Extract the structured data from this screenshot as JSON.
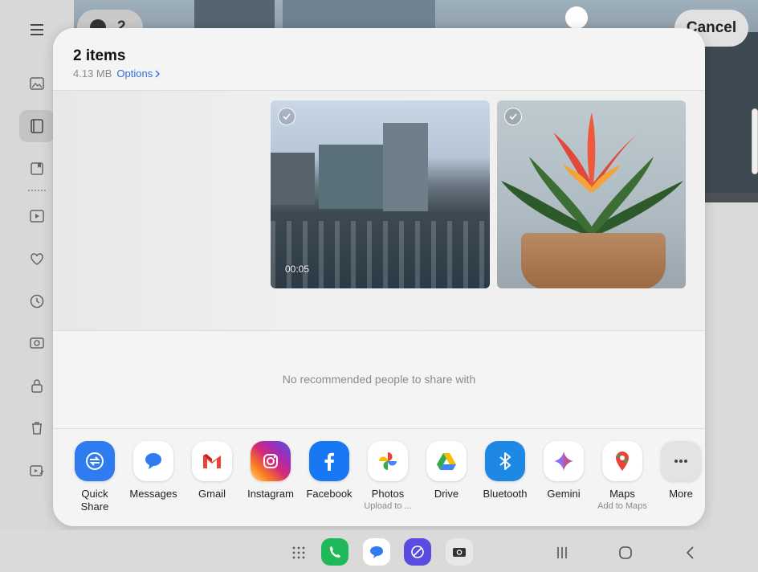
{
  "background": {
    "cancel_label": "Cancel",
    "selection_count": "2"
  },
  "sheet": {
    "title": "2 items",
    "size": "4.13 MB",
    "options_label": "Options",
    "video_duration": "00:05",
    "no_people_text": "No recommended people to share with"
  },
  "apps": [
    {
      "label": "Quick Share",
      "sub": "",
      "icon": "quick-share-icon",
      "color": "#2f7bf0"
    },
    {
      "label": "Messages",
      "sub": "",
      "icon": "messages-icon",
      "color": "#ffffff"
    },
    {
      "label": "Gmail",
      "sub": "",
      "icon": "gmail-icon",
      "color": "#ffffff"
    },
    {
      "label": "Instagram",
      "sub": "",
      "icon": "instagram-icon",
      "color": "#e1306c"
    },
    {
      "label": "Facebook",
      "sub": "",
      "icon": "facebook-icon",
      "color": "#1877f2"
    },
    {
      "label": "Photos",
      "sub": "Upload to ...",
      "icon": "photos-icon",
      "color": "#ffffff"
    },
    {
      "label": "Drive",
      "sub": "",
      "icon": "drive-icon",
      "color": "#ffffff"
    },
    {
      "label": "Bluetooth",
      "sub": "",
      "icon": "bluetooth-icon",
      "color": "#1e88e5"
    },
    {
      "label": "Gemini",
      "sub": "",
      "icon": "gemini-icon",
      "color": "#ffffff"
    },
    {
      "label": "Maps",
      "sub": "Add to Maps",
      "icon": "maps-icon",
      "color": "#ffffff"
    },
    {
      "label": "More",
      "sub": "",
      "icon": "more-icon",
      "color": "#e3e3e3"
    }
  ]
}
